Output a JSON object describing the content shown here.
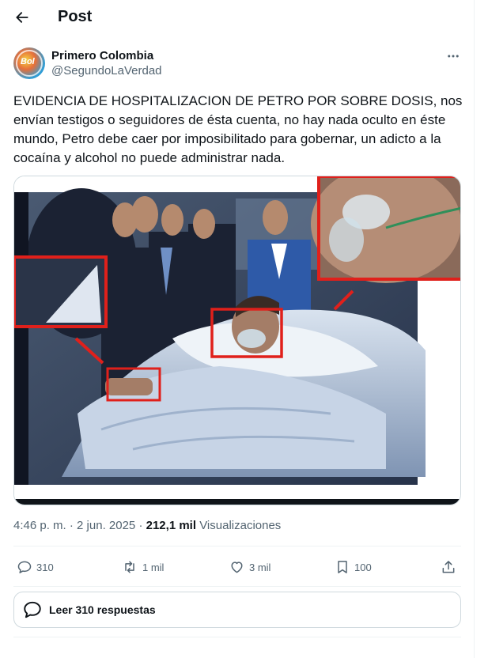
{
  "header": {
    "title": "Post",
    "back_icon": "arrow-left-icon"
  },
  "author": {
    "name": "Primero Colombia",
    "handle": "@SegundoLaVerdad",
    "avatar_text": "Bol"
  },
  "tweet": {
    "text": "EVIDENCIA DE HOSPITALIZACION DE PETRO POR SOBRE DOSIS, nos\nenvían testigos o seguidores de ésta cuenta, no hay nada oculto en éste\nmundo, Petro debe caer por imposibilitado para gobernar, un adicto a la\ncocaína y alcohol no puede administrar nada."
  },
  "meta": {
    "time": "4:46 p. m.",
    "separator": "·",
    "date": "2 jun. 2025",
    "views_count": "212,1 mil",
    "views_label": "Visualizaciones"
  },
  "actions": {
    "reply": {
      "count": "310",
      "icon": "reply-icon"
    },
    "repost": {
      "count": "1 mil",
      "icon": "repost-icon"
    },
    "like": {
      "count": "3 mil",
      "icon": "heart-icon"
    },
    "bookmark": {
      "count": "100",
      "icon": "bookmark-icon"
    },
    "share": {
      "icon": "share-icon"
    }
  },
  "replies_button": {
    "label": "Leer 310 respuestas",
    "icon": "chat-bubble-icon"
  },
  "colors": {
    "text": "#0f1419",
    "secondary": "#536471",
    "border": "#cfd9de",
    "highlight_box": "#e0201b"
  }
}
